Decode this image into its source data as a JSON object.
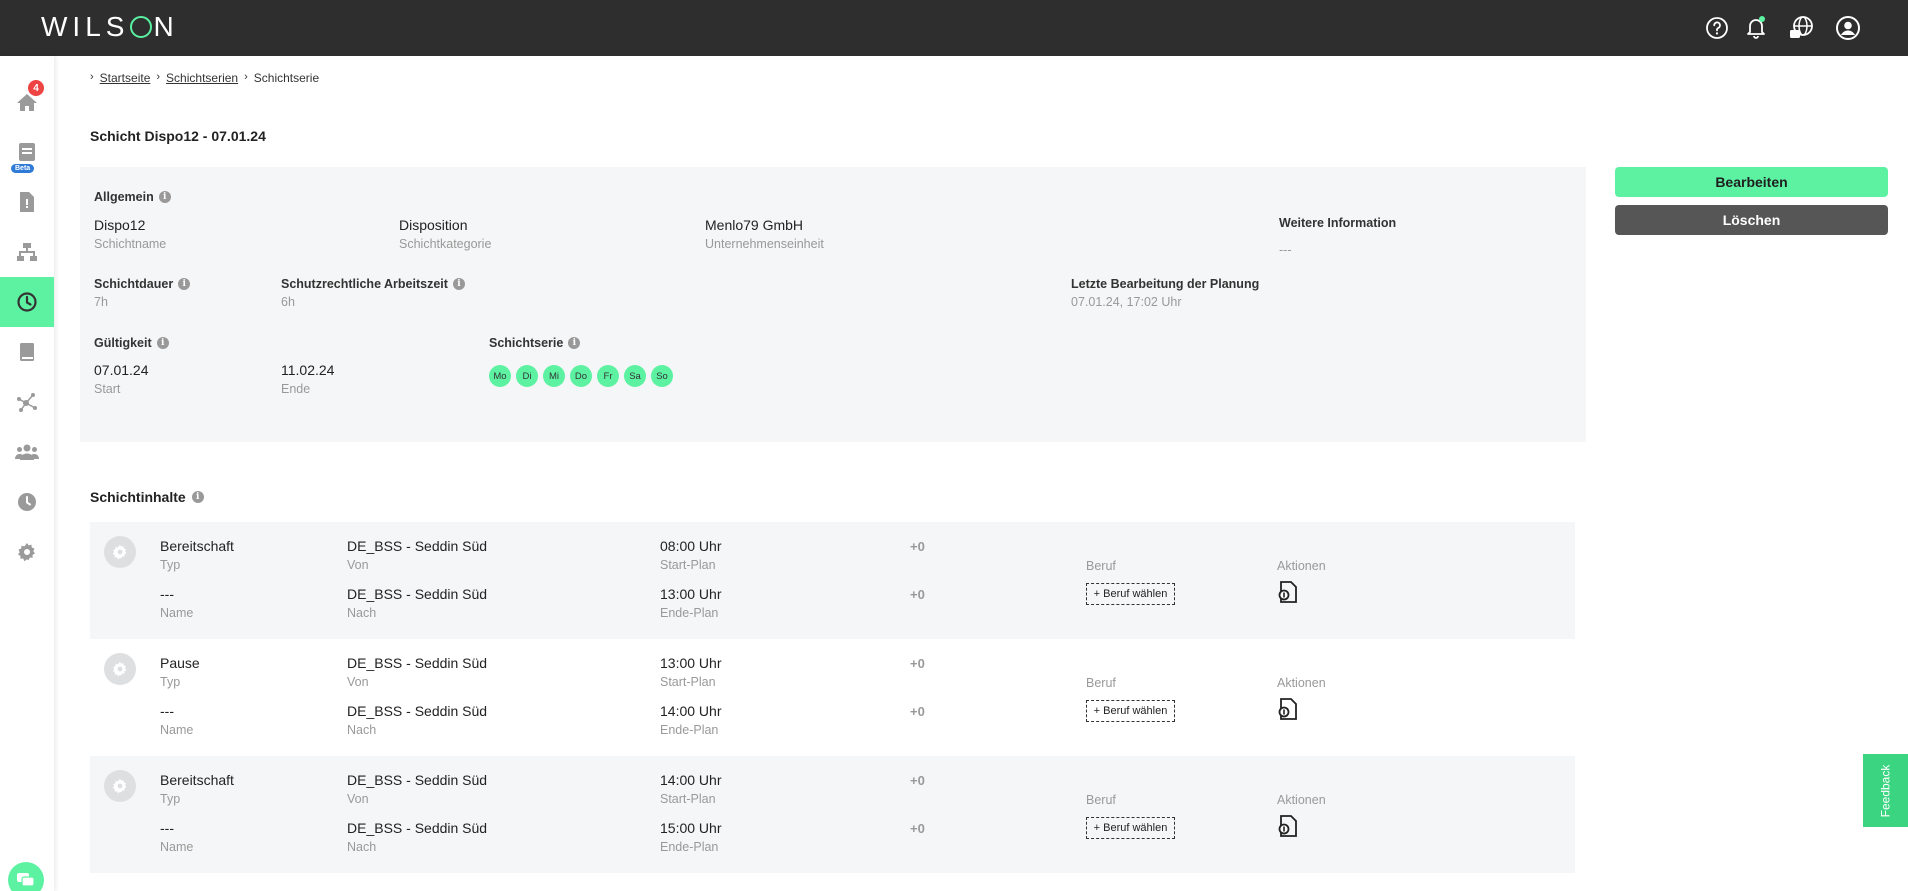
{
  "app": {
    "logo_text_left": "WILS",
    "logo_text_right": "N"
  },
  "sidebar": {
    "notification_count": "4",
    "beta_label": "Beta"
  },
  "breadcrumb": {
    "items": [
      "Startseite",
      "Schichtserien",
      "Schichtserie"
    ]
  },
  "page": {
    "title": "Schicht Dispo12 - 07.01.24"
  },
  "general": {
    "heading": "Allgemein",
    "name_value": "Dispo12",
    "name_label": "Schichtname",
    "category_value": "Disposition",
    "category_label": "Schichtkategorie",
    "unit_value": "Menlo79 GmbH",
    "unit_label": "Unternehmenseinheit",
    "more_info_heading": "Weitere Information",
    "more_info_value": "---",
    "duration_heading": "Schichtdauer",
    "duration_value": "7h",
    "protected_heading": "Schutzrechtliche Arbeitszeit",
    "protected_value": "6h",
    "last_edit_heading": "Letzte Bearbeitung der Planung",
    "last_edit_value": "07.01.24, 17:02 Uhr",
    "validity_heading": "Gültigkeit",
    "start_value": "07.01.24",
    "start_label": "Start",
    "end_value": "11.02.24",
    "end_label": "Ende",
    "series_heading": "Schichtserie",
    "days": [
      "Mo",
      "Di",
      "Mi",
      "Do",
      "Fr",
      "Sa",
      "So"
    ]
  },
  "actions": {
    "edit_label": "Bearbeiten",
    "delete_label": "Löschen"
  },
  "contents": {
    "heading": "Schichtinhalte",
    "labels": {
      "typ": "Typ",
      "name": "Name",
      "von": "Von",
      "nach": "Nach",
      "start_plan": "Start-Plan",
      "end_plan": "Ende-Plan",
      "beruf": "Beruf",
      "aktionen": "Aktionen",
      "beruf_button": "+ Beruf wählen"
    },
    "rows": [
      {
        "type": "Bereitschaft",
        "name": "---",
        "from": "DE_BSS - Seddin Süd",
        "to": "DE_BSS - Seddin Süd",
        "start": "08:00 Uhr",
        "end": "13:00 Uhr",
        "start_offset": "+0",
        "end_offset": "+0"
      },
      {
        "type": "Pause",
        "name": "---",
        "from": "DE_BSS - Seddin Süd",
        "to": "DE_BSS - Seddin Süd",
        "start": "13:00 Uhr",
        "end": "14:00 Uhr",
        "start_offset": "+0",
        "end_offset": "+0"
      },
      {
        "type": "Bereitschaft",
        "name": "---",
        "from": "DE_BSS - Seddin Süd",
        "to": "DE_BSS - Seddin Süd",
        "start": "14:00 Uhr",
        "end": "15:00 Uhr",
        "start_offset": "+0",
        "end_offset": "+0"
      }
    ]
  },
  "feedback": {
    "label": "Feedback"
  },
  "colors": {
    "accent": "#5cf2a2",
    "topbar": "#2e2e2e",
    "delete": "#565656",
    "panel": "#f5f6f7"
  }
}
